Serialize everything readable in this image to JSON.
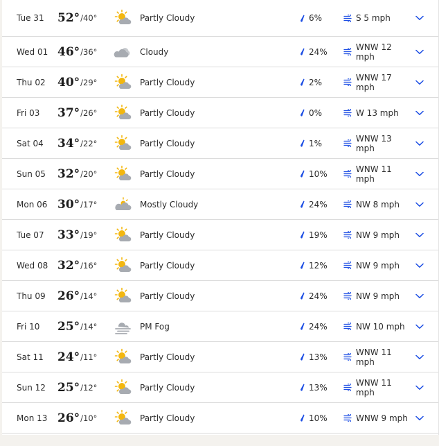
{
  "days": [
    {
      "day": "Tue 31",
      "hi": "52°",
      "lo": "/40°",
      "icon": "partly-cloudy",
      "condition": "Partly Cloudy",
      "precip": "6%",
      "wind": "S 5 mph"
    },
    {
      "day": "Wed 01",
      "hi": "46°",
      "lo": "/36°",
      "icon": "cloudy",
      "condition": "Cloudy",
      "precip": "24%",
      "wind": "WNW 12 mph"
    },
    {
      "day": "Thu 02",
      "hi": "40°",
      "lo": "/29°",
      "icon": "partly-cloudy",
      "condition": "Partly Cloudy",
      "precip": "2%",
      "wind": "WNW 17 mph"
    },
    {
      "day": "Fri 03",
      "hi": "37°",
      "lo": "/26°",
      "icon": "partly-cloudy",
      "condition": "Partly Cloudy",
      "precip": "0%",
      "wind": "W 13 mph"
    },
    {
      "day": "Sat 04",
      "hi": "34°",
      "lo": "/22°",
      "icon": "partly-cloudy",
      "condition": "Partly Cloudy",
      "precip": "1%",
      "wind": "WNW 13 mph"
    },
    {
      "day": "Sun 05",
      "hi": "32°",
      "lo": "/20°",
      "icon": "partly-cloudy",
      "condition": "Partly Cloudy",
      "precip": "10%",
      "wind": "WNW 11 mph"
    },
    {
      "day": "Mon 06",
      "hi": "30°",
      "lo": "/17°",
      "icon": "mostly-cloudy",
      "condition": "Mostly Cloudy",
      "precip": "24%",
      "wind": "NW 8 mph"
    },
    {
      "day": "Tue 07",
      "hi": "33°",
      "lo": "/19°",
      "icon": "partly-cloudy",
      "condition": "Partly Cloudy",
      "precip": "19%",
      "wind": "NW 9 mph"
    },
    {
      "day": "Wed 08",
      "hi": "32°",
      "lo": "/16°",
      "icon": "partly-cloudy",
      "condition": "Partly Cloudy",
      "precip": "12%",
      "wind": "NW 9 mph"
    },
    {
      "day": "Thu 09",
      "hi": "26°",
      "lo": "/14°",
      "icon": "partly-cloudy",
      "condition": "Partly Cloudy",
      "precip": "24%",
      "wind": "NW 9 mph"
    },
    {
      "day": "Fri 10",
      "hi": "25°",
      "lo": "/14°",
      "icon": "fog",
      "condition": "PM Fog",
      "precip": "24%",
      "wind": "NW 10 mph"
    },
    {
      "day": "Sat 11",
      "hi": "24°",
      "lo": "/11°",
      "icon": "partly-cloudy",
      "condition": "Partly Cloudy",
      "precip": "13%",
      "wind": "WNW 11 mph"
    },
    {
      "day": "Sun 12",
      "hi": "25°",
      "lo": "/12°",
      "icon": "partly-cloudy",
      "condition": "Partly Cloudy",
      "precip": "13%",
      "wind": "WNW 11 mph"
    },
    {
      "day": "Mon 13",
      "hi": "26°",
      "lo": "/10°",
      "icon": "partly-cloudy",
      "condition": "Partly Cloudy",
      "precip": "10%",
      "wind": "WNW 9 mph"
    }
  ],
  "colors": {
    "accent": "#1b4de4",
    "sun": "#f3b70f",
    "cloud": "#a7abb1",
    "divider": "#dcdcdc"
  }
}
